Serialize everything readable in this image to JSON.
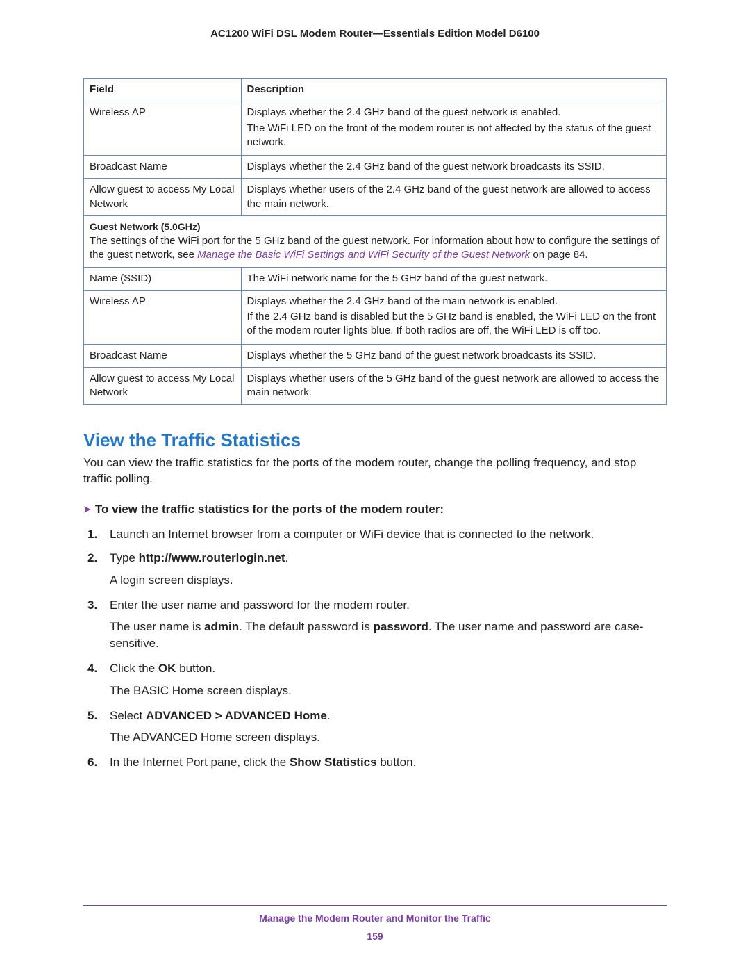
{
  "doc_title": "AC1200 WiFi DSL Modem Router—Essentials Edition Model D6100",
  "table": {
    "headers": {
      "field": "Field",
      "description": "Description"
    },
    "rows_top": [
      {
        "field": "Wireless AP",
        "desc1": "Displays whether the 2.4 GHz band of the guest network is enabled.",
        "desc2": "The WiFi LED on the front of the modem router is not affected by the status of the guest network."
      },
      {
        "field": "Broadcast Name",
        "desc1": "Displays whether the 2.4 GHz band of the guest network broadcasts its SSID."
      },
      {
        "field": "Allow guest to access My Local Network",
        "desc1": "Displays whether users of the 2.4 GHz band of the guest network are allowed to access the main network."
      }
    ],
    "section5": {
      "heading": "Guest Network (5.0GHz)",
      "text_before_link": "The settings of the WiFi port for the 5 GHz band of the guest network. For information about how to configure the settings of the guest network, see ",
      "link_text": "Manage the Basic WiFi Settings and WiFi Security of the Guest Network",
      "text_after_link": " on page 84."
    },
    "rows_bottom": [
      {
        "field": "Name (SSID)",
        "desc1": "The WiFi network name for the 5 GHz band of the guest network."
      },
      {
        "field": "Wireless AP",
        "desc1": "Displays whether the 2.4 GHz band of the main network is enabled.",
        "desc2": "If the 2.4 GHz band is disabled but the 5 GHz band is enabled, the WiFi LED on the front of the modem router lights blue. If both radios are off, the WiFi LED is off too."
      },
      {
        "field": "Broadcast Name",
        "desc1": "Displays whether the 5 GHz band of the guest network broadcasts its SSID."
      },
      {
        "field": "Allow guest to access My Local Network",
        "desc1": "Displays whether users of the 5 GHz band of the guest network are allowed to access the main network."
      }
    ]
  },
  "section_title": "View the Traffic Statistics",
  "intro": "You can view the traffic statistics for the ports of the modem router, change the polling frequency, and stop traffic polling.",
  "proc_lead": "To view the traffic statistics for the ports of the modem router:",
  "steps": {
    "s1": {
      "num": "1.",
      "text": "Launch an Internet browser from a computer or WiFi device that is connected to the network."
    },
    "s2": {
      "num": "2.",
      "pre": "Type ",
      "bold": "http://www.routerlogin.net",
      "post": ".",
      "after": "A login screen displays."
    },
    "s3": {
      "num": "3.",
      "text": "Enter the user name and password for the modem router.",
      "after_pre1": "The user name is ",
      "after_b1": "admin",
      "after_mid": ". The default password is ",
      "after_b2": "password",
      "after_post": ". The user name and password are case-sensitive."
    },
    "s4": {
      "num": "4.",
      "pre": "Click the ",
      "bold": "OK",
      "post": " button.",
      "after": "The BASIC Home screen displays."
    },
    "s5": {
      "num": "5.",
      "pre": "Select ",
      "bold": "ADVANCED > ADVANCED Home",
      "post": ".",
      "after": "The ADVANCED Home screen displays."
    },
    "s6": {
      "num": "6.",
      "pre": "In the Internet Port pane, click the ",
      "bold": "Show Statistics",
      "post": " button."
    }
  },
  "footer_title": "Manage the Modem Router and Monitor the Traffic",
  "page_number": "159"
}
